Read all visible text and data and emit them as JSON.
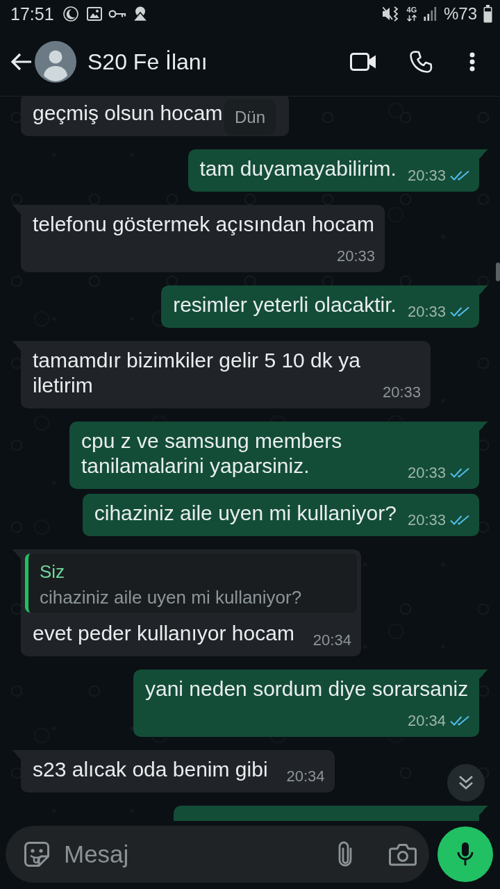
{
  "status_bar": {
    "time": "17:51",
    "network": "4G",
    "battery": "%73"
  },
  "header": {
    "title": "S20 Fe İlanı"
  },
  "date_chip": {
    "label": "Dün"
  },
  "messages": [
    {
      "kind": "incoming",
      "tail": false,
      "text": "geçmiş olsun hocam"
    },
    {
      "kind": "outgoing",
      "tail": true,
      "text": "tam duyamayabilirim.",
      "time": "20:33",
      "read": true
    },
    {
      "kind": "incoming",
      "tail": true,
      "text": "telefonu göstermek açısından hocam",
      "time": "20:33"
    },
    {
      "kind": "outgoing",
      "tail": true,
      "text": "resimler yeterli olacaktir.",
      "time": "20:33",
      "read": true
    },
    {
      "kind": "incoming",
      "tail": true,
      "text": "tamamdır bizimkiler gelir 5 10 dk ya iletirim",
      "time": "20:33"
    },
    {
      "kind": "outgoing",
      "tail": true,
      "text": "cpu z ve samsung members tanilamalarini yaparsiniz.",
      "time": "20:33",
      "read": true
    },
    {
      "kind": "outgoing",
      "tail": false,
      "text": "cihaziniz aile uyen mi kullaniyor?",
      "time": "20:33",
      "read": true
    },
    {
      "kind": "incoming",
      "tail": true,
      "quote": {
        "author": "Siz",
        "text": "cihaziniz aile uyen mi kullaniyor?"
      },
      "text": "evet peder kullanıyor hocam",
      "time": "20:34"
    },
    {
      "kind": "outgoing",
      "tail": true,
      "text": "yani neden sordum diye sorarsaniz",
      "time": "20:34",
      "read": true
    },
    {
      "kind": "incoming",
      "tail": true,
      "text": "s23 alıcak oda benim gibi",
      "time": "20:34"
    },
    {
      "kind": "outgoing",
      "tail": true
    }
  ],
  "composer": {
    "placeholder": "Mesaj"
  }
}
